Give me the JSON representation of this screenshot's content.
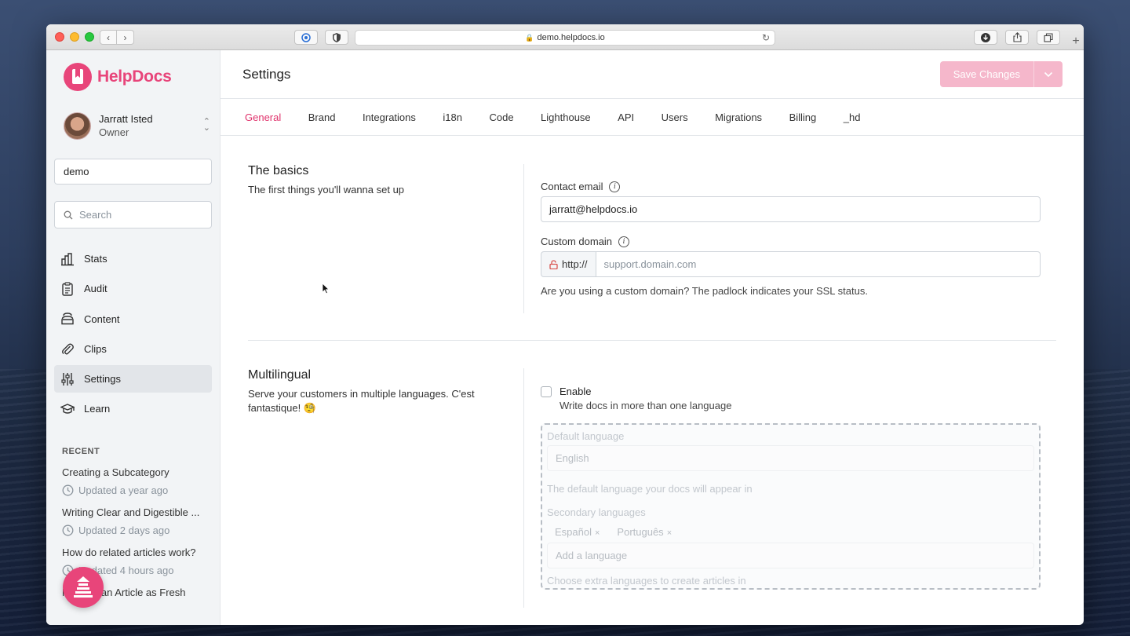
{
  "browser": {
    "url": "demo.helpdocs.io"
  },
  "sidebar": {
    "brand": "HelpDocs",
    "user": {
      "name": "Jarratt Isted",
      "role": "Owner"
    },
    "kb_value": "demo",
    "search_placeholder": "Search",
    "nav": [
      {
        "label": "Stats",
        "icon": "chart-icon"
      },
      {
        "label": "Audit",
        "icon": "clipboard-icon"
      },
      {
        "label": "Content",
        "icon": "layers-icon"
      },
      {
        "label": "Clips",
        "icon": "paperclip-icon"
      },
      {
        "label": "Settings",
        "icon": "sliders-icon",
        "active": true
      },
      {
        "label": "Learn",
        "icon": "graduation-cap-icon"
      }
    ],
    "recent_heading": "RECENT",
    "recent": [
      {
        "title": "Creating a Subcategory",
        "meta": "Updated a year ago"
      },
      {
        "title": "Writing Clear and Digestible ...",
        "meta": "Updated 2 days ago"
      },
      {
        "title": "How do related articles work?",
        "meta": "Updated 4 hours ago"
      },
      {
        "title": "Marking an Article as Fresh",
        "meta": ""
      }
    ]
  },
  "header": {
    "title": "Settings",
    "save_label": "Save Changes"
  },
  "tabs": [
    "General",
    "Brand",
    "Integrations",
    "i18n",
    "Code",
    "Lighthouse",
    "API",
    "Users",
    "Migrations",
    "Billing",
    "_hd"
  ],
  "active_tab": "General",
  "basics": {
    "title": "The basics",
    "description": "The first things you'll wanna set up",
    "contact_email_label": "Contact email",
    "contact_email_value": "jarratt@helpdocs.io",
    "custom_domain_label": "Custom domain",
    "domain_prefix": "http://",
    "domain_placeholder": "support.domain.com",
    "domain_help": "Are you using a custom domain? The padlock indicates your SSL status."
  },
  "multilingual": {
    "title": "Multilingual",
    "description": "Serve your customers in multiple languages. C'est fantastique! 🧐",
    "enable_label": "Enable",
    "enable_sub": "Write docs in more than one language",
    "enabled": false,
    "default_language_label": "Default language",
    "default_language_value": "English",
    "default_language_help": "The default language your docs will appear in",
    "secondary_label": "Secondary languages",
    "secondary_tags": [
      "Español",
      "Português"
    ],
    "add_language_placeholder": "Add a language",
    "secondary_help": "Choose extra languages to create articles in"
  },
  "colors": {
    "brand": "#e8457a",
    "accent_text": "#e0336c",
    "save_disabled": "#f5b7cb"
  }
}
